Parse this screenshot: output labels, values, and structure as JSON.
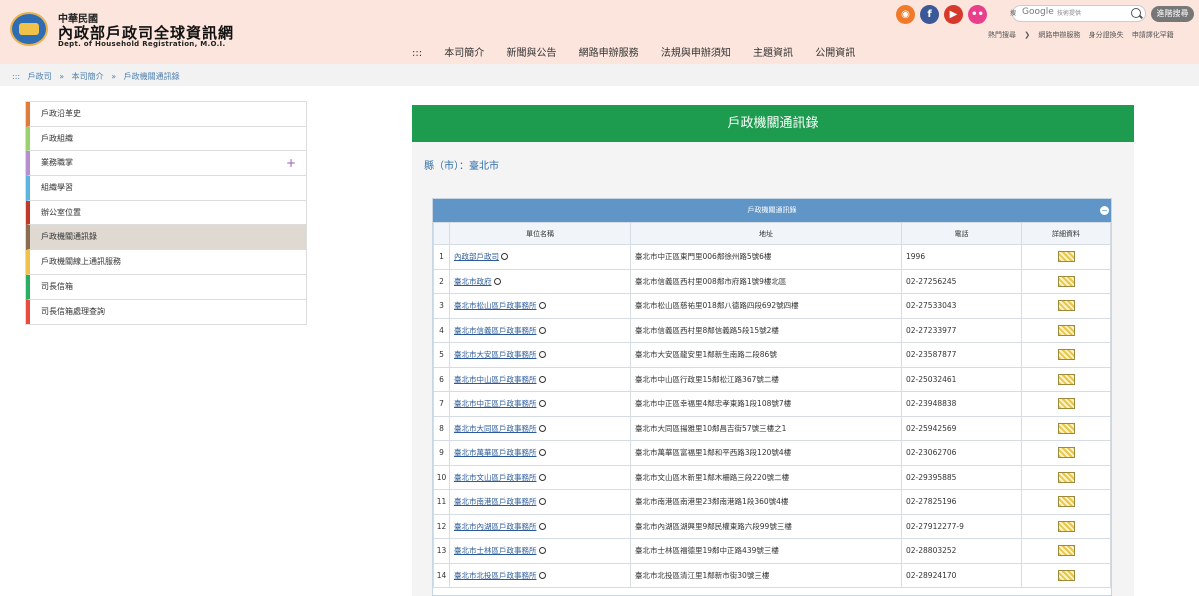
{
  "header": {
    "org_line1": "中華民國",
    "org_line2": "內政部戶政司全球資訊網",
    "org_line3": "Dept. of Household Registration, M.O.I.",
    "social": [
      "rss-icon",
      "facebook-icon",
      "youtube-icon",
      "flickr-icon"
    ],
    "search": {
      "label": "搜",
      "provider": "Google",
      "placeholder": "技術提供"
    },
    "advanced_search": "進階搜尋",
    "quick_links": [
      "熱門搜尋",
      "網路申辦服務",
      "身分證換失",
      "申請譯化罕籍"
    ],
    "nav": [
      "本司簡介",
      "新聞與公告",
      "網路申辦服務",
      "法規與申辦須知",
      "主題資訊",
      "公開資訊"
    ]
  },
  "breadcrumb": [
    ":::",
    "戶政司",
    "»",
    "本司簡介",
    "»",
    "戶政機關通訊錄"
  ],
  "sidebar": {
    "items": [
      {
        "label": "戶政沿革史",
        "color": "#e07b3a"
      },
      {
        "label": "戶政組織",
        "color": "#9bd06f"
      },
      {
        "label": "業務職掌",
        "color": "#b58fd0"
      },
      {
        "label": "組織學習",
        "color": "#5ab5e0"
      },
      {
        "label": "辦公室位置",
        "color": "#c0392b"
      },
      {
        "label": "戶政機關通訊錄",
        "color": "#8a6d4e"
      },
      {
        "label": "戶政機關線上通訊服務",
        "color": "#f0c24a"
      },
      {
        "label": "司長信箱",
        "color": "#27ae60"
      },
      {
        "label": "司長信箱處理查詢",
        "color": "#e74c3c"
      }
    ]
  },
  "main": {
    "title": "戶政機關通訊錄",
    "county": "縣（市）：臺北市",
    "table_caption": "戶政機關通訊錄",
    "columns": [
      "單位名稱",
      "地址",
      "電話",
      "詳細資料"
    ],
    "rows": [
      [
        "1",
        "內政部戶政司",
        "臺北市中正區東門里006鄰徐州路5號6樓",
        "1996"
      ],
      [
        "2",
        "臺北市政府",
        "臺北市信義區西村里008鄰市府路1號9樓北區",
        "02-27256245"
      ],
      [
        "3",
        "臺北市松山區戶政事務所",
        "臺北市松山區慈祐里018鄰八德路四段692號四樓",
        "02-27533043"
      ],
      [
        "4",
        "臺北市信義區戶政事務所",
        "臺北市信義區西村里8鄰信義路5段15號2樓",
        "02-27233977"
      ],
      [
        "5",
        "臺北市大安區戶政事務所",
        "臺北市大安區龍安里1鄰新生南路二段86號",
        "02-23587877"
      ],
      [
        "6",
        "臺北市中山區戶政事務所",
        "臺北市中山區行政里15鄰松江路367號二樓",
        "02-25032461"
      ],
      [
        "7",
        "臺北市中正區戶政事務所",
        "臺北市中正區幸福里4鄰忠孝東路1段108號7樓",
        "02-23948838"
      ],
      [
        "8",
        "臺北市大同區戶政事務所",
        "臺北市大同區揚雅里10鄰昌吉街57號三樓之1",
        "02-25942569"
      ],
      [
        "9",
        "臺北市萬華區戶政事務所",
        "臺北市萬華區富福里1鄰和平西路3段120號4樓",
        "02-23062706"
      ],
      [
        "10",
        "臺北市文山區戶政事務所",
        "臺北市文山區木新里1鄰木柵路三段220號二樓",
        "02-29395885"
      ],
      [
        "11",
        "臺北市南港區戶政事務所",
        "臺北市南港區南港里23鄰南港路1段360號4樓",
        "02-27825196"
      ],
      [
        "12",
        "臺北市內湖區戶政事務所",
        "臺北市內湖區湖興里9鄰民權東路六段99號三樓",
        "02-27912277-9"
      ],
      [
        "13",
        "臺北市士林區戶政事務所",
        "臺北市士林區福德里19鄰中正路439號三樓",
        "02-28803252"
      ],
      [
        "14",
        "臺北市北投區戶政事務所",
        "臺北市北投區清江里1鄰新市街30號三樓",
        "02-28924170"
      ]
    ]
  }
}
